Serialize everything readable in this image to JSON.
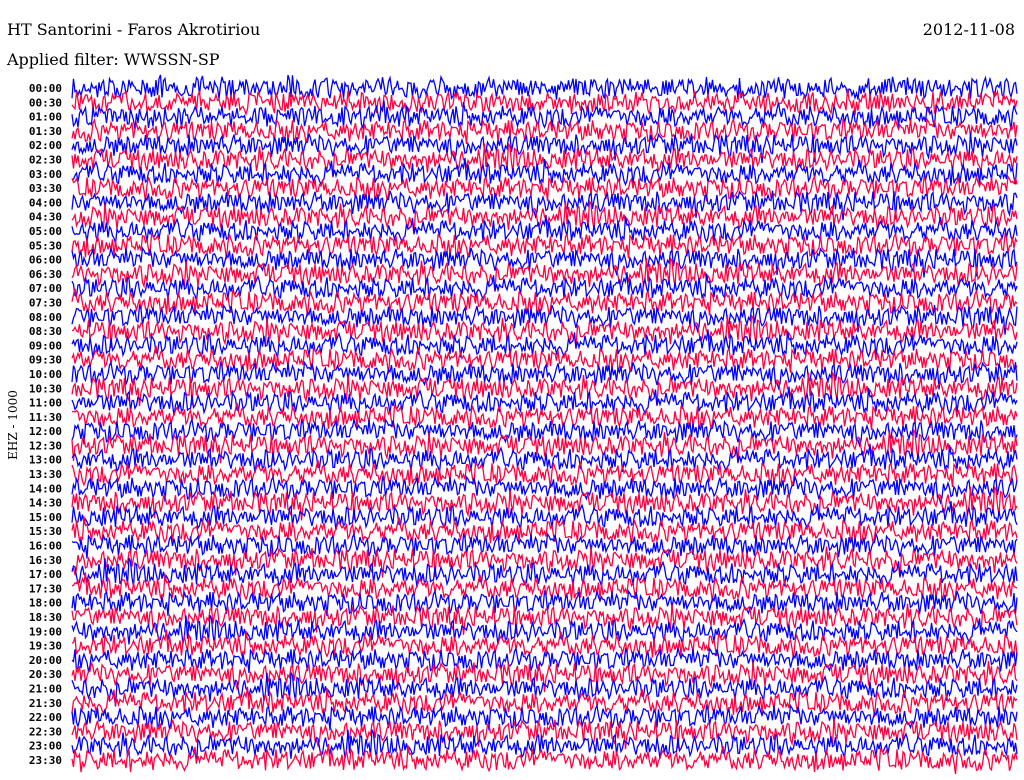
{
  "header": {
    "title": "HT Santorini - Faros Akrotiriou",
    "date": "2012-11-08",
    "filter": "Applied filter: WWSSN-SP"
  },
  "chart_data": {
    "type": "line",
    "title": "HT Santorini - Faros Akrotiriou",
    "ylabel": "EHZ - 1000",
    "xlabel": "",
    "grid": false,
    "series_colors": [
      "#0000ff",
      "#ff0040"
    ],
    "row_labels": [
      "00:00",
      "00:30",
      "01:00",
      "01:30",
      "02:00",
      "02:30",
      "03:00",
      "03:30",
      "04:00",
      "04:30",
      "05:00",
      "05:30",
      "06:00",
      "06:30",
      "07:00",
      "07:30",
      "08:00",
      "08:30",
      "09:00",
      "09:30",
      "10:00",
      "10:30",
      "11:00",
      "11:30",
      "12:00",
      "12:30",
      "13:00",
      "13:30",
      "14:00",
      "14:30",
      "15:00",
      "15:30",
      "16:00",
      "16:30",
      "17:00",
      "17:30",
      "18:00",
      "18:30",
      "19:00",
      "19:30",
      "20:00",
      "20:30",
      "21:00",
      "21:30",
      "22:00",
      "22:30",
      "23:00",
      "23:30"
    ]
  }
}
